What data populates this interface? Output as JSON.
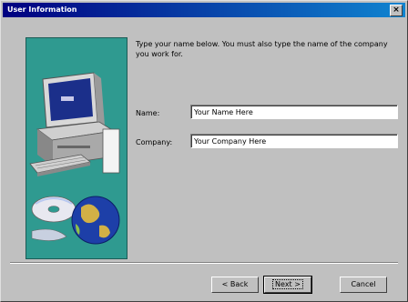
{
  "window": {
    "title": "User Information",
    "close_label": "×"
  },
  "instruction": "Type your name below. You must also type the name of the company you work for.",
  "form": {
    "name_label": "Name:",
    "name_value": "Your Name Here",
    "company_label": "Company:",
    "company_value": "Your Company Here"
  },
  "buttons": {
    "back": "< Back",
    "next": "Next >",
    "cancel": "Cancel"
  },
  "colors": {
    "title_start": "#000080",
    "title_end": "#1084d0",
    "art_bg": "#2f9a90",
    "dialog_bg": "#c0c0c0"
  },
  "icons": [
    "computer-icon",
    "cd-disc-icon",
    "globe-icon"
  ]
}
